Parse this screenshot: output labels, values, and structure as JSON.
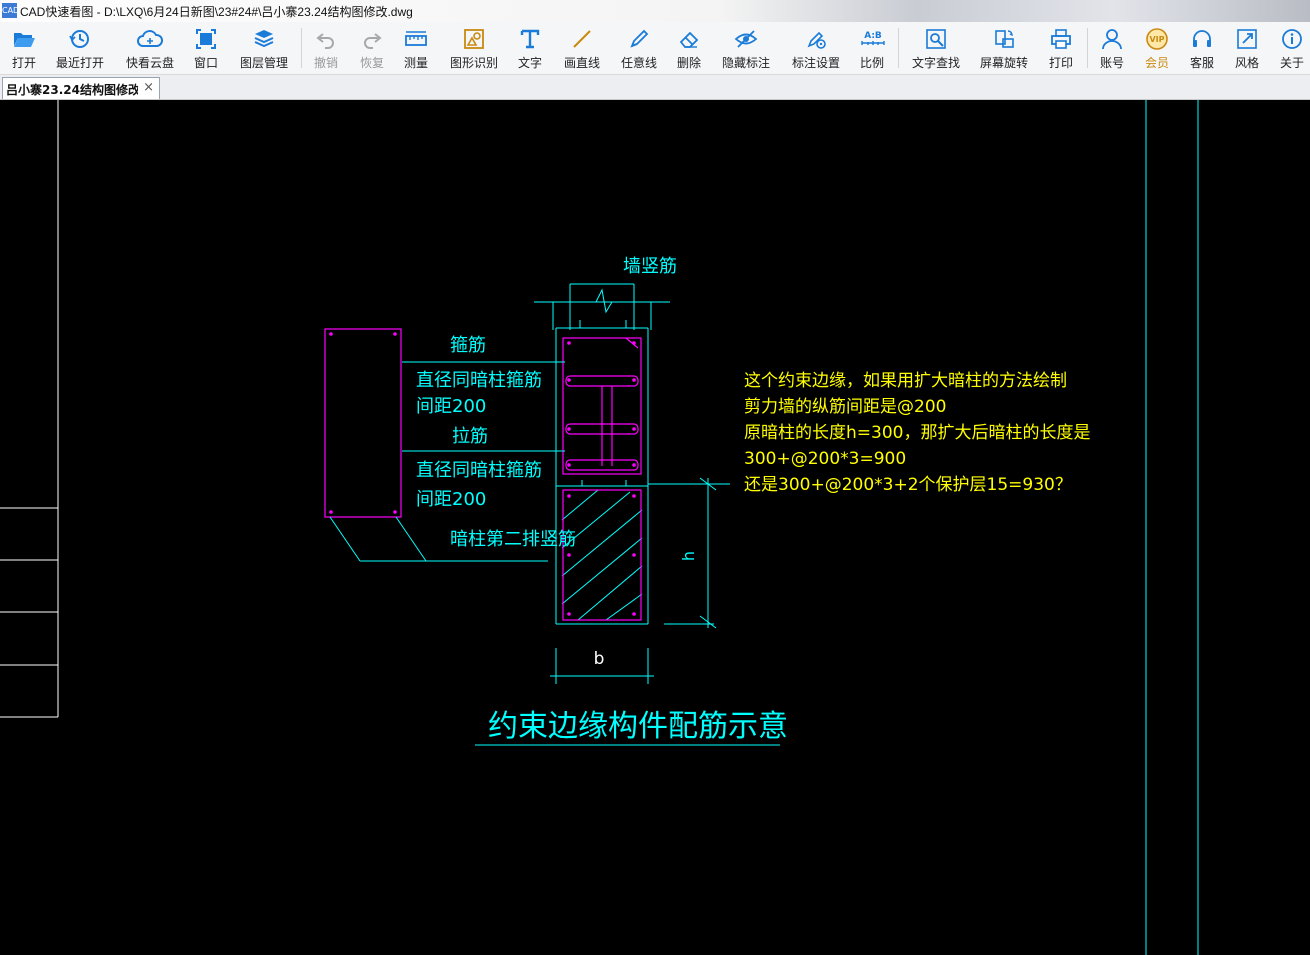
{
  "window": {
    "app_icon": "CAD",
    "title": "CAD快速看图 - D:\\LXQ\\6月24日新图\\23#24#\\吕小寨23.24结构图修改.dwg"
  },
  "toolbar": {
    "open": "打开",
    "recent": "最近打开",
    "cloud": "快看云盘",
    "window": "窗口",
    "layers": "图层管理",
    "undo": "撤销",
    "redo": "恢复",
    "measure": "测量",
    "shape_recog": "图形识别",
    "text": "文字",
    "line": "画直线",
    "freeline": "任意线",
    "erase": "删除",
    "hide_annot": "隐藏标注",
    "annot_settings": "标注设置",
    "scale": "比例",
    "scale_icon_text": "A:B",
    "text_search": "文字查找",
    "rotate": "屏幕旋转",
    "print": "打印",
    "account": "账号",
    "vip": "会员",
    "vip_icon_text": "VIP",
    "service": "客服",
    "style": "风格",
    "about": "关于"
  },
  "tab": {
    "label": "吕小寨23.24结构图修改",
    "close": "×"
  },
  "drawing": {
    "wall_rebar": "墙竖筋",
    "stirrup": "箍筋",
    "stirrup_spec_1": "直径同暗柱箍筋",
    "stirrup_spacing_1": "间距200",
    "tie_bar": "拉筋",
    "stirrup_spec_2": "直径同暗柱箍筋",
    "stirrup_spacing_2": "间距200",
    "second_row": "暗柱第二排竖筋",
    "dim_h": "h",
    "dim_b": "b",
    "caption": "约束边缘构件配筋示意"
  },
  "note": {
    "line1": "这个约束边缘，如果用扩大暗柱的方法绘制",
    "line2": "剪力墙的纵筋间距是@200",
    "line3": "原暗柱的长度h=300，那扩大后暗柱的长度是",
    "line4": "300+@200*3=900",
    "line5": "还是300+@200*3+2个保护层15=930？"
  },
  "colors": {
    "cyan": "#00ffff",
    "magenta": "#ff00ff",
    "yellow": "#ffff00",
    "white": "#ffffff",
    "icon_blue": "#1a7bd8"
  }
}
